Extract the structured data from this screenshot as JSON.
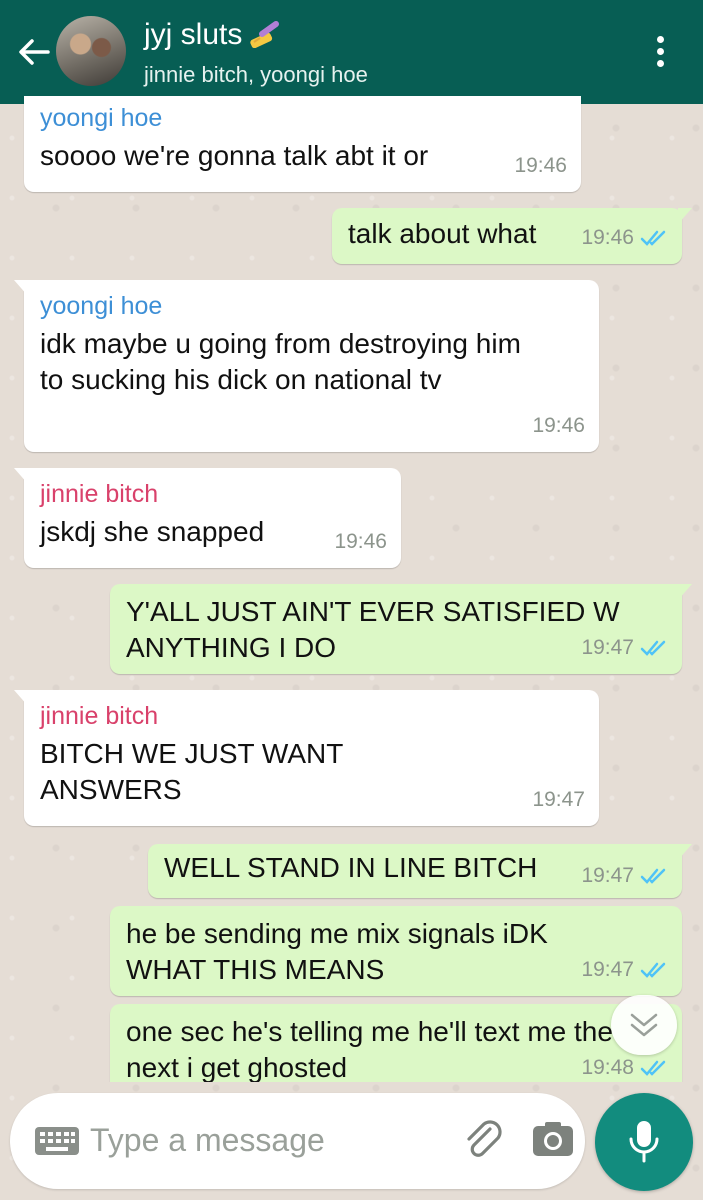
{
  "header": {
    "title": "jyj sluts",
    "title_emoji": "nail-polish",
    "subtitle": "jinnie bitch, yoongi hoe",
    "colors": {
      "bar": "#075e54",
      "text": "#ffffff"
    }
  },
  "messages": [
    {
      "direction": "in",
      "sender": "yoongi hoe",
      "text": "soooo we're gonna talk abt it or",
      "time": "19:46"
    },
    {
      "direction": "out",
      "text": "talk about what",
      "time": "19:46",
      "status": "read"
    },
    {
      "direction": "in",
      "sender": "yoongi hoe",
      "text": "idk maybe u going from destroying him to sucking his dick on national tv",
      "time": "19:46"
    },
    {
      "direction": "in",
      "sender": "jinnie bitch",
      "text": "jskdj she snapped",
      "time": "19:46"
    },
    {
      "direction": "out",
      "text": "Y'ALL JUST AIN'T EVER SATISFIED W ANYTHING I DO",
      "time": "19:47",
      "status": "read"
    },
    {
      "direction": "in",
      "sender": "jinnie bitch",
      "text": "BITCH WE JUST WANT ANSWERS",
      "time": "19:47"
    },
    {
      "direction": "out",
      "text": "WELL STAND IN LINE BITCH",
      "time": "19:47",
      "status": "read"
    },
    {
      "direction": "out",
      "text": "he be sending me mix signals iDK WHAT THIS MEANS",
      "time": "19:47",
      "status": "read"
    },
    {
      "direction": "out",
      "text": "one sec he's telling me he'll text me the next i get ghosted",
      "time": "19:48",
      "status": "read"
    }
  ],
  "composer": {
    "placeholder": "Type a message"
  },
  "colors": {
    "incoming_bubble": "#ffffff",
    "outgoing_bubble": "#dcf8c6",
    "sender_yoongi": "#3d8fd6",
    "sender_jinnie": "#d9416b",
    "read_check": "#4fc3f7",
    "mic_button": "#128c7e"
  }
}
